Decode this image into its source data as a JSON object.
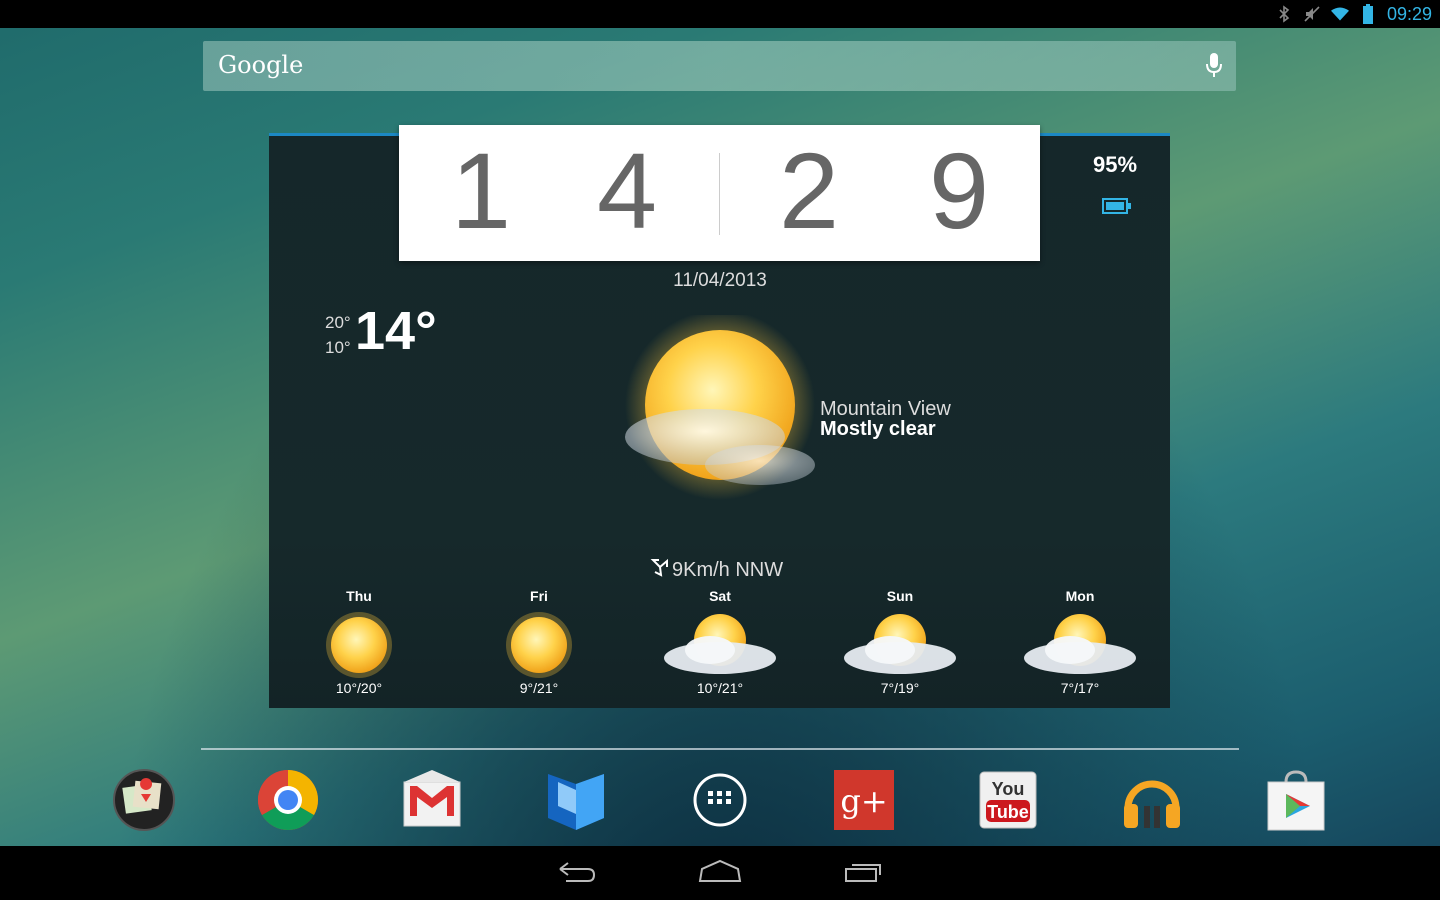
{
  "status_bar": {
    "time": "09:29"
  },
  "search": {
    "logo": "Google",
    "mic_icon": "mic-icon"
  },
  "clock": {
    "digits": [
      "1",
      "4",
      "2",
      "9"
    ]
  },
  "battery": {
    "percent": "95%"
  },
  "weather": {
    "date": "11/04/2013",
    "high": "20°",
    "low": "10°",
    "current": "14°",
    "location": "Mountain View",
    "condition": "Mostly clear",
    "wind": "9Km/h NNW",
    "forecast": [
      {
        "day": "Thu",
        "temps": "10°/20°",
        "icon": "sun"
      },
      {
        "day": "Fri",
        "temps": "9°/21°",
        "icon": "sun"
      },
      {
        "day": "Sat",
        "temps": "10°/21°",
        "icon": "partly-cloudy"
      },
      {
        "day": "Sun",
        "temps": "7°/19°",
        "icon": "partly-cloudy"
      },
      {
        "day": "Mon",
        "temps": "7°/17°",
        "icon": "partly-cloudy"
      }
    ]
  },
  "dock": {
    "apps": [
      "Maps",
      "Chrome",
      "Gmail",
      "Play Books",
      "Apps",
      "Google+",
      "YouTube",
      "Play Music",
      "Play Store"
    ],
    "youtube_top": "You",
    "youtube_bottom": "Tube",
    "gplus": "g+"
  },
  "colors": {
    "accent": "#33b5e5",
    "widget_bg": "#16292b",
    "gplus": "#d0372c"
  }
}
